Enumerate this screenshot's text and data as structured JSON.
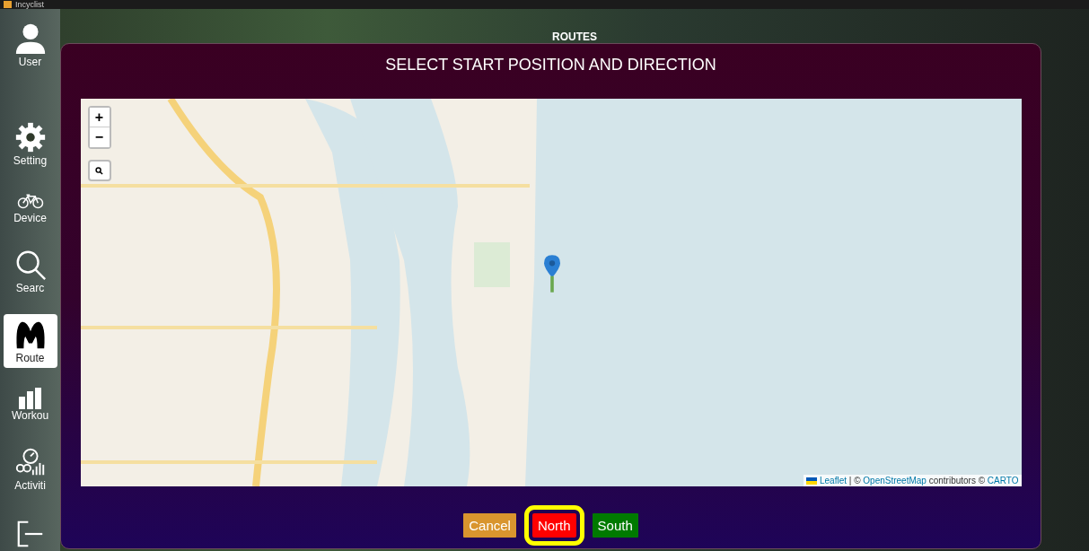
{
  "window": {
    "title": "Incyclist"
  },
  "sidebar": {
    "items": [
      {
        "label": "User",
        "kind": "user",
        "selected": false
      },
      {
        "label": "Setting",
        "kind": "settings",
        "selected": false
      },
      {
        "label": "Device",
        "kind": "device",
        "selected": false
      },
      {
        "label": "Searc",
        "kind": "search",
        "selected": false
      },
      {
        "label": "Route",
        "kind": "route",
        "selected": true
      },
      {
        "label": "Workou",
        "kind": "workout",
        "selected": false
      },
      {
        "label": "Activiti",
        "kind": "activity",
        "selected": false
      }
    ]
  },
  "page": {
    "title": "ROUTES"
  },
  "dialog": {
    "title": "SELECT START POSITION AND DIRECTION",
    "map": {
      "zoom_in": "+",
      "zoom_out": "−",
      "attribution": [
        {
          "text": "Leaflet",
          "link": true
        },
        {
          "text": " | © ",
          "link": false
        },
        {
          "text": "OpenStreetMap",
          "link": true
        },
        {
          "text": " contributors © ",
          "link": false
        },
        {
          "text": "CARTO",
          "link": true
        }
      ]
    },
    "buttons": [
      {
        "label": "Cancel",
        "kind": "cancel",
        "selected": false
      },
      {
        "label": "North",
        "kind": "north",
        "selected": true
      },
      {
        "label": "South",
        "kind": "south",
        "selected": false
      }
    ]
  }
}
